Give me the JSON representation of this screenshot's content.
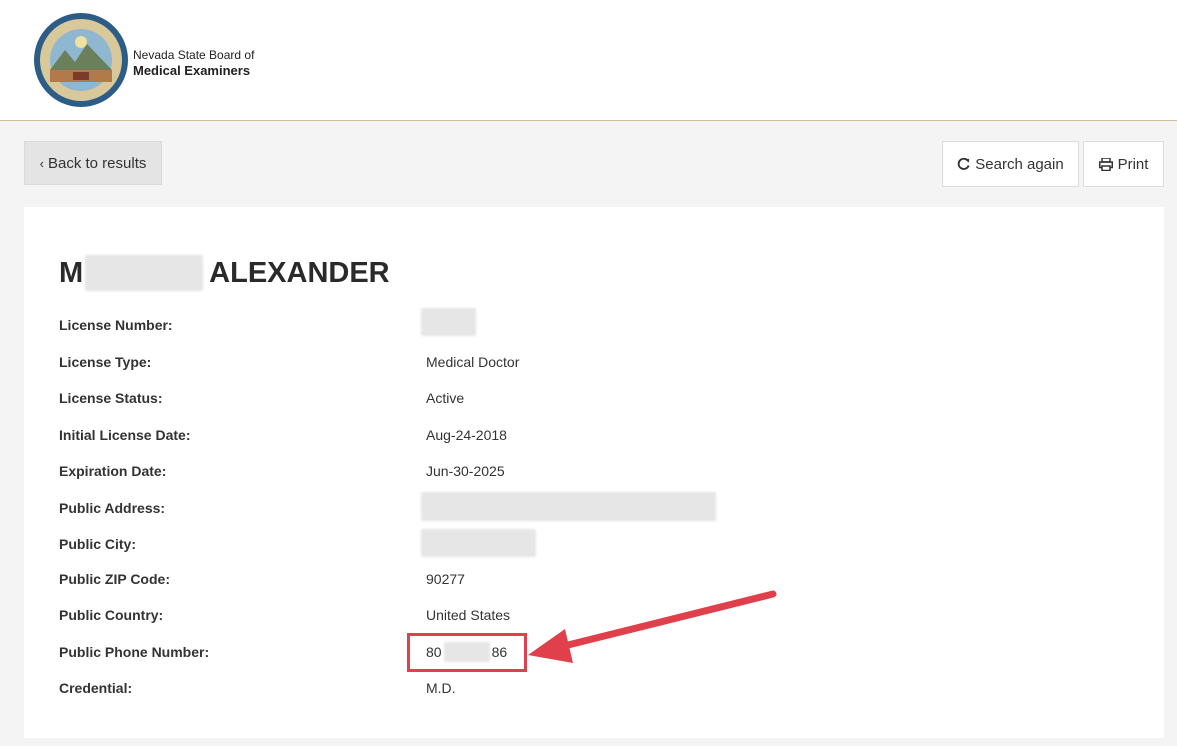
{
  "header": {
    "org_line1": "Nevada State Board of",
    "org_line2": "Medical Examiners",
    "seal_icon": "nevada-state-seal-icon"
  },
  "toolbar": {
    "back_label": "Back to results",
    "search_again_label": "Search again",
    "print_label": "Print"
  },
  "profile": {
    "name_first_initial": "M",
    "name_last": "ALEXANDER",
    "fields": [
      {
        "label": "License Number:",
        "value": ""
      },
      {
        "label": "License Type:",
        "value": "Medical Doctor"
      },
      {
        "label": "License Status:",
        "value": "Active"
      },
      {
        "label": "Initial License Date:",
        "value": "Aug-24-2018"
      },
      {
        "label": "Expiration Date:",
        "value": "Jun-30-2025"
      },
      {
        "label": "Public Address:",
        "value": ""
      },
      {
        "label": "Public City:",
        "value": ""
      },
      {
        "label": "Public ZIP Code:",
        "value": "90277"
      },
      {
        "label": "Public Country:",
        "value": "United States"
      },
      {
        "label": "Public Phone Number:",
        "value_start": "80",
        "value_end": "86"
      },
      {
        "label": "Credential:",
        "value": "M.D."
      }
    ]
  },
  "annotation": {
    "highlight_color": "#e0404b"
  }
}
